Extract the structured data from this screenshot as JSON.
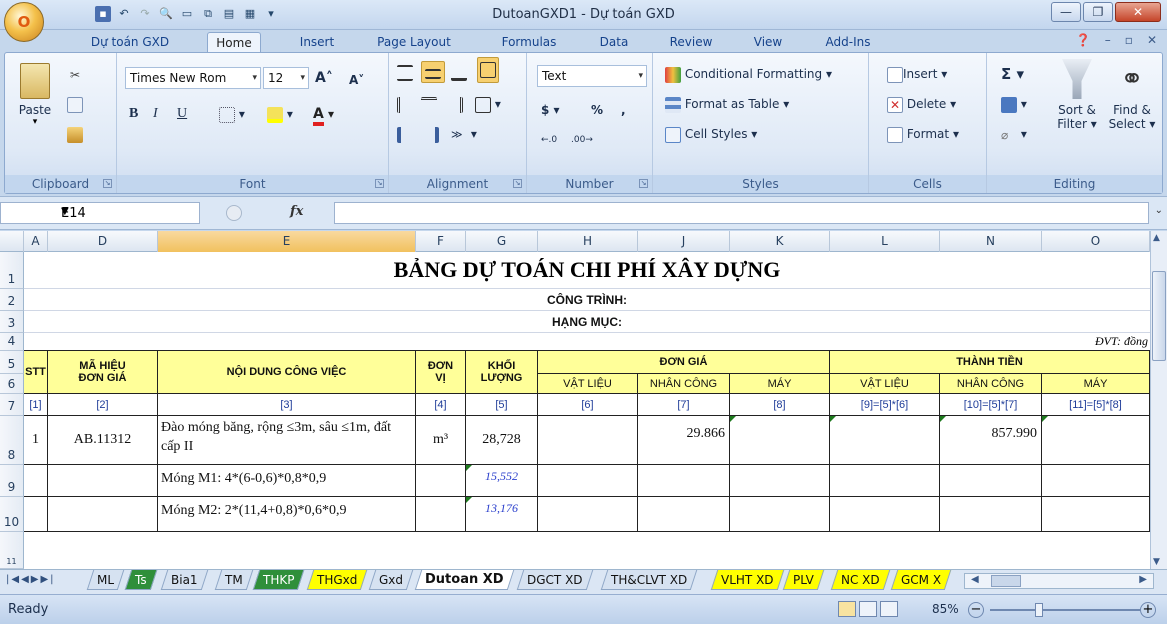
{
  "titlebar": {
    "title": "DutoanGXD1 - Dự toán GXD",
    "office_button": "O"
  },
  "ribbon_tabs": [
    "Dự toán GXD",
    "Home",
    "Insert",
    "Page Layout",
    "Formulas",
    "Data",
    "Review",
    "View",
    "Add-Ins"
  ],
  "ribbon": {
    "clipboard": {
      "paste": "Paste",
      "label": "Clipboard"
    },
    "font": {
      "name": "Times New Rom",
      "size": "12",
      "label": "Font",
      "bold": "B",
      "italic": "I",
      "underline": "U"
    },
    "alignment": {
      "label": "Alignment"
    },
    "number": {
      "format": "Text",
      "currency": "$",
      "percent": "%",
      "comma": ",",
      "label": "Number"
    },
    "styles": {
      "conditional": "Conditional Formatting",
      "table": "Format as Table",
      "cell": "Cell Styles",
      "label": "Styles"
    },
    "cells": {
      "insert": "Insert",
      "delete": "Delete",
      "format": "Format",
      "label": "Cells"
    },
    "editing": {
      "sort": "Sort &",
      "sort2": "Filter",
      "find": "Find &",
      "find2": "Select",
      "label": "Editing"
    }
  },
  "formula_bar": {
    "name_box": "E14",
    "fx": "fx",
    "value": ""
  },
  "columns": [
    "A",
    "D",
    "E",
    "F",
    "G",
    "H",
    "J",
    "K",
    "L",
    "N",
    "O"
  ],
  "selected_column": "E",
  "rows": [
    "1",
    "2",
    "3",
    "4",
    "5",
    "6",
    "7",
    "8",
    "9",
    "10",
    "11"
  ],
  "sheet": {
    "title": "BẢNG DỰ TOÁN CHI PHÍ XÂY DỰNG",
    "cong_trinh": "CÔNG TRÌNH:",
    "hang_muc": "HẠNG MỤC:",
    "dvt": "ĐVT: đồng",
    "headers": {
      "stt": "STT",
      "ma_hieu": "MÃ HIỆU ĐƠN GIÁ",
      "noi_dung": "NỘI DUNG CÔNG VIỆC",
      "don_vi": "ĐƠN VỊ",
      "khoi_luong": "KHỐI LƯỢNG",
      "don_gia": "ĐƠN GIÁ",
      "thanh_tien": "THÀNH TIỀN",
      "vat_lieu": "VẬT LIỆU",
      "nhan_cong": "NHÂN CÔNG",
      "may": "MÁY"
    },
    "index_row": [
      "[1]",
      "[2]",
      "[3]",
      "[4]",
      "[5]",
      "[6]",
      "[7]",
      "[8]",
      "[9]=[5]*[6]",
      "[10]=[5]*[7]",
      "[11]=[5]*[8]"
    ],
    "row8": {
      "stt": "1",
      "code": "AB.11312",
      "desc": "Đào móng băng, rộng ≤3m, sâu ≤1m, đất cấp II",
      "unit": "m³",
      "qty": "28,728",
      "nc": "29.866",
      "tt_nc": "857.990"
    },
    "row9": {
      "desc": "Móng M1: 4*(6-0,6)*0,8*0,9",
      "qty": "15,552"
    },
    "row10": {
      "desc": "Móng M2: 2*(11,4+0,8)*0,6*0,9",
      "qty": "13,176"
    }
  },
  "sheet_tabs": [
    "ML",
    "Ts",
    "Bia1",
    "TM",
    "THKP",
    "THGxd",
    "Gxd",
    "Dutoan XD",
    "DGCT XD",
    "TH&CLVT XD",
    "VLHT XD",
    "PLV",
    "NC XD",
    "GCM X"
  ],
  "active_sheet": "Dutoan XD",
  "status": {
    "ready": "Ready",
    "zoom": "85%"
  },
  "colors": {
    "header_yellow": "#ffff99",
    "selected_col": "#f1c15e",
    "tab_yellow": "#ffff00",
    "tab_green": "#2f8f3a"
  }
}
